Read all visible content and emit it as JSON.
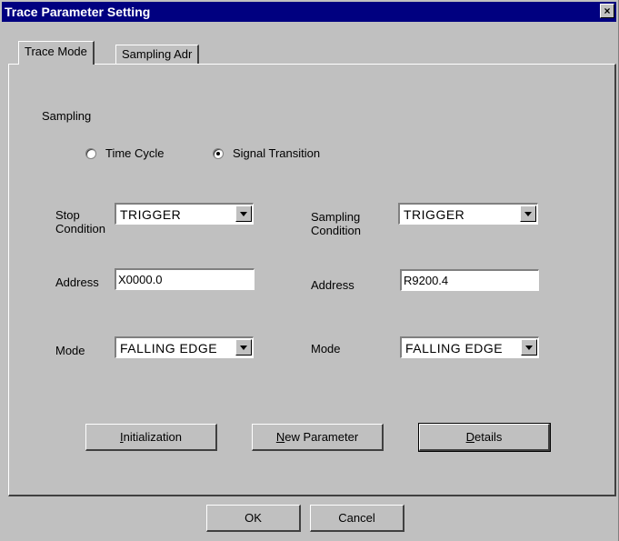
{
  "window": {
    "title": "Trace Parameter Setting",
    "close_glyph": "×"
  },
  "tabs": [
    {
      "label": "Trace Mode",
      "active": true
    },
    {
      "label": "Sampling Adr",
      "active": false
    }
  ],
  "sampling": {
    "group_label": "Sampling",
    "options": [
      {
        "label": "Time Cycle",
        "selected": false
      },
      {
        "label": "Signal Transition",
        "selected": true
      }
    ]
  },
  "left": {
    "stop_label_1": "Stop",
    "stop_label_2": "Condition",
    "stop_value": "TRIGGER",
    "address_label": "Address",
    "address_value": "X0000.0",
    "mode_label": "Mode",
    "mode_value": "FALLING EDGE"
  },
  "right": {
    "sampling_label_1": "Sampling",
    "sampling_label_2": "Condition",
    "sampling_value": "TRIGGER",
    "address_label": "Address",
    "address_value": "R9200.4",
    "mode_label": "Mode",
    "mode_value": "FALLING EDGE"
  },
  "buttons": {
    "initialization": {
      "mnemonic": "I",
      "rest": "nitialization"
    },
    "new_parameter": {
      "mnemonic": "N",
      "rest": "ew Parameter"
    },
    "details": {
      "mnemonic": "D",
      "rest": "etails"
    },
    "ok": "OK",
    "cancel": "Cancel"
  }
}
